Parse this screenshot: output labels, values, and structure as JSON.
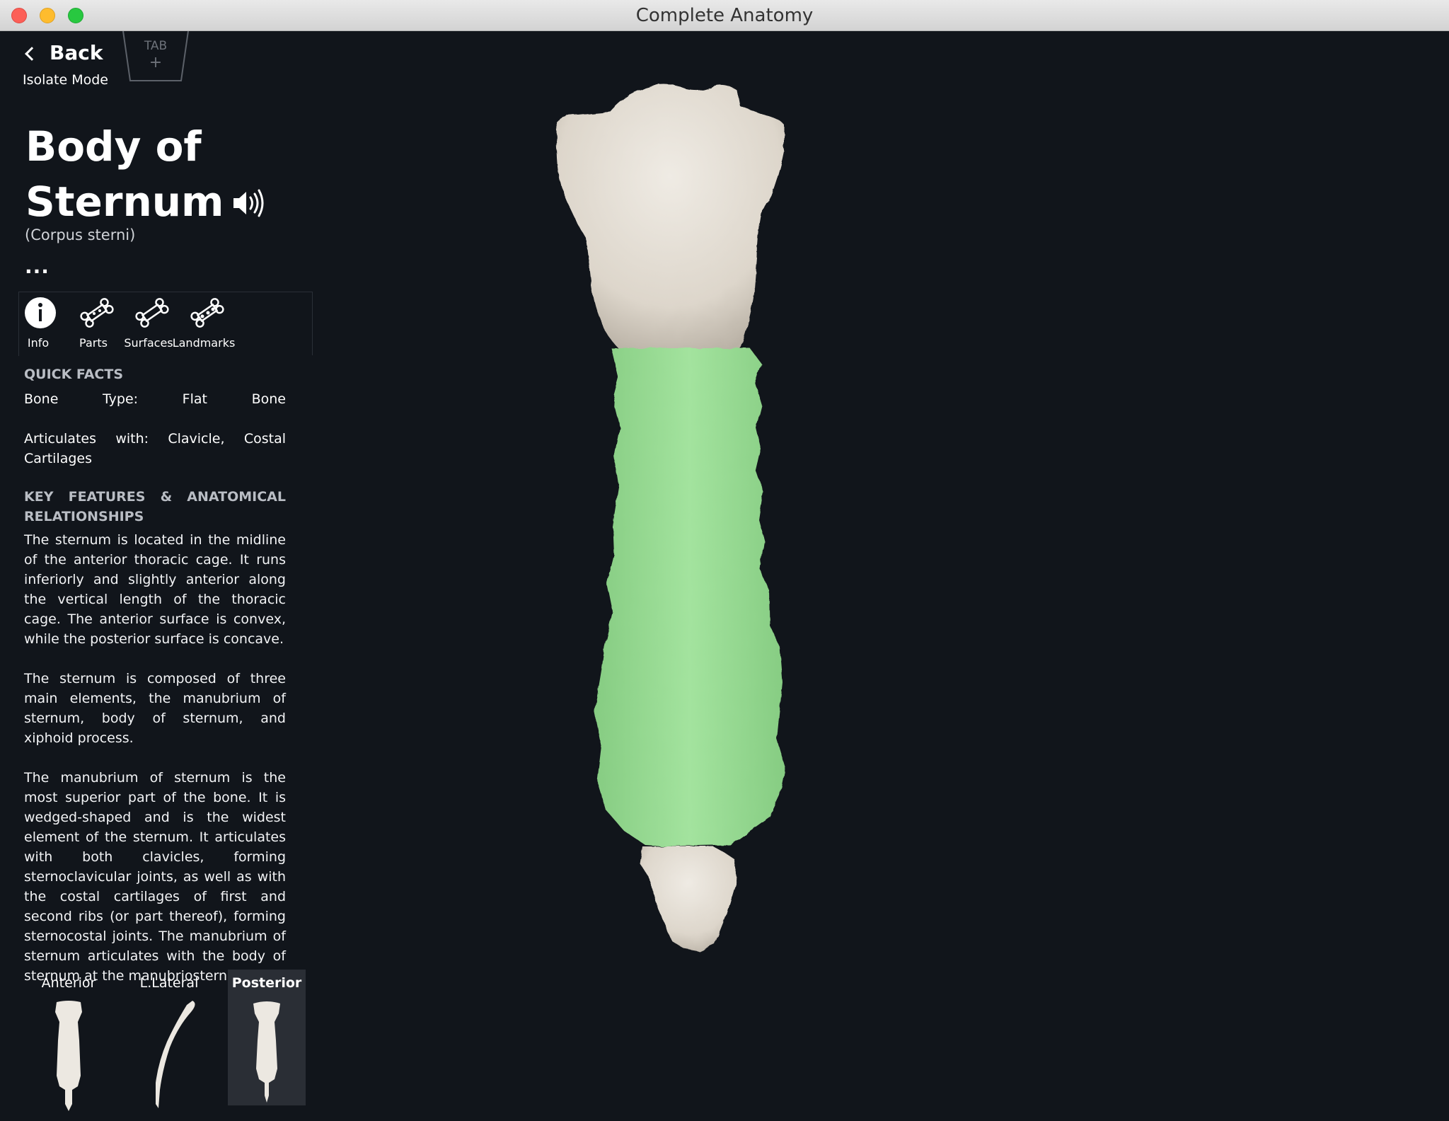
{
  "window": {
    "title": "Complete Anatomy"
  },
  "nav": {
    "back_label": "Back",
    "mode_label": "Isolate Mode",
    "tab_label": "TAB",
    "tab_add": "+"
  },
  "structure": {
    "title_line1": "Body of",
    "title_line2": "Sternum",
    "latin": "(Corpus sterni)",
    "more": "..."
  },
  "tabs": [
    {
      "label": "Info",
      "icon": "info-icon"
    },
    {
      "label": "Parts",
      "icon": "bone-icon"
    },
    {
      "label": "Surfaces",
      "icon": "bone-outline-icon"
    },
    {
      "label": "Landmarks",
      "icon": "bone-landmarks-icon"
    }
  ],
  "quick_facts": {
    "heading": "QUICK FACTS",
    "bone_type": [
      "Bone",
      "Type:",
      "Flat",
      "Bone"
    ],
    "articulates": [
      "Articulates",
      "with:",
      "Clavicle,",
      "Costal"
    ],
    "articulates_line2": "Cartilages"
  },
  "key_features": {
    "heading_line1": [
      "KEY",
      "FEATURES",
      "&",
      "ANATOMICAL"
    ],
    "heading_line2": "RELATIONSHIPS",
    "p1": "The sternum is located in the midline of the anterior thoracic cage. It runs inferiorly and slightly anterior along the vertical length of the thoracic cage. The anterior surface is convex, while the posterior surface is concave.",
    "p2": "The sternum is composed of three main elements, the manubrium of sternum, body of sternum, and xiphoid process.",
    "p3": "The manubrium of sternum is the most superior part of the bone. It is wedged-shaped and is the widest element of the sternum. It articulates with both clavicles, forming sternoclavicular joints, as well as with the costal cartilages of first and second ribs (or part thereof), forming sternocostal joints. The manubrium of sternum articulates with the body of sternum at the manubriosternal joint."
  },
  "views": [
    {
      "label": "Anterior",
      "active": false
    },
    {
      "label": "L.Lateral",
      "active": false
    },
    {
      "label": "Posterior",
      "active": true
    }
  ],
  "colors": {
    "background": "#11151b",
    "bone": "#e8e3da",
    "highlight": "#9fe09a"
  }
}
